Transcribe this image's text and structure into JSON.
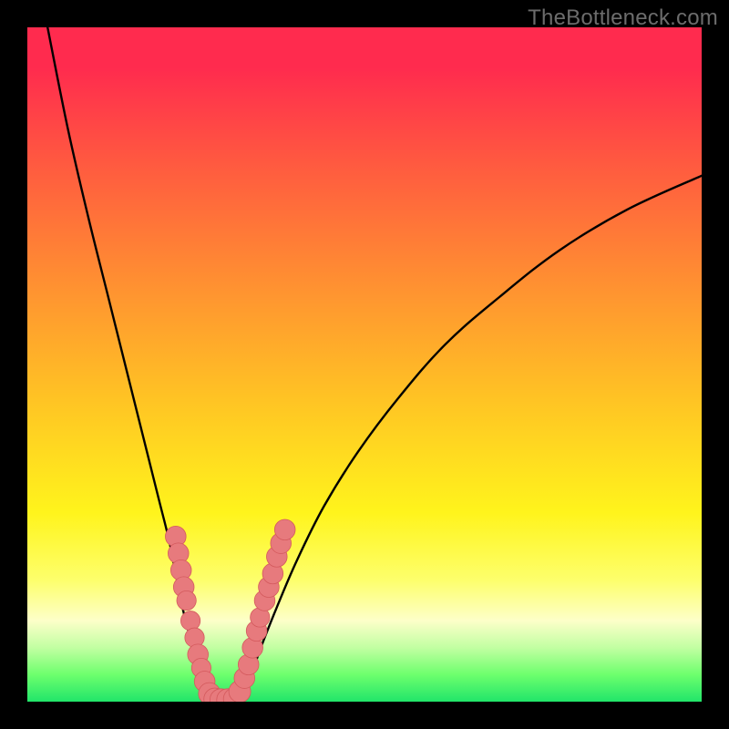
{
  "watermark": "TheBottleneck.com",
  "colors": {
    "frame": "#000000",
    "curve": "#000000",
    "marker_fill": "#e77a7d",
    "marker_stroke": "#d45a5d",
    "gradient_stops": [
      "#ff2b4e",
      "#ff5940",
      "#ff8a33",
      "#ffc324",
      "#fff41c",
      "#fdff6c",
      "#fdffc9",
      "#c2ffa2",
      "#6dff6d",
      "#21e56a"
    ]
  },
  "chart_data": {
    "type": "line",
    "title": "",
    "xlabel": "",
    "ylabel": "",
    "xlim": [
      0,
      100
    ],
    "ylim": [
      0,
      100
    ],
    "series": [
      {
        "name": "left-curve",
        "x": [
          3,
          6,
          9,
          12,
          14,
          16,
          18,
          19.5,
          21,
          22,
          23,
          24,
          25,
          25.8,
          26.5,
          27
        ],
        "y": [
          100,
          85,
          72,
          60,
          52,
          44,
          36,
          30,
          24,
          19,
          14,
          10,
          6,
          3.5,
          1.5,
          0.3
        ]
      },
      {
        "name": "right-curve",
        "x": [
          31,
          32,
          33.5,
          35,
          37,
          40,
          44,
          49,
          55,
          62,
          70,
          79,
          89,
          100
        ],
        "y": [
          0.3,
          2,
          5,
          9,
          14,
          21,
          29,
          37,
          45,
          53,
          60,
          67,
          73,
          78
        ]
      },
      {
        "name": "valley-floor",
        "x": [
          27,
          31
        ],
        "y": [
          0.3,
          0.3
        ]
      }
    ],
    "markers": {
      "name": "data-points",
      "points": [
        {
          "x": 22.0,
          "y": 24.5,
          "r": 1.1
        },
        {
          "x": 22.4,
          "y": 22.0,
          "r": 1.1
        },
        {
          "x": 22.8,
          "y": 19.5,
          "r": 1.1
        },
        {
          "x": 23.2,
          "y": 17.0,
          "r": 1.1
        },
        {
          "x": 23.6,
          "y": 15.0,
          "r": 1.0
        },
        {
          "x": 24.2,
          "y": 12.0,
          "r": 1.0
        },
        {
          "x": 24.8,
          "y": 9.5,
          "r": 1.0
        },
        {
          "x": 25.3,
          "y": 7.0,
          "r": 1.1
        },
        {
          "x": 25.8,
          "y": 5.0,
          "r": 1.0
        },
        {
          "x": 26.3,
          "y": 3.0,
          "r": 1.1
        },
        {
          "x": 27.0,
          "y": 1.2,
          "r": 1.2
        },
        {
          "x": 27.8,
          "y": 0.4,
          "r": 1.2
        },
        {
          "x": 28.7,
          "y": 0.3,
          "r": 1.2
        },
        {
          "x": 29.7,
          "y": 0.3,
          "r": 1.2
        },
        {
          "x": 30.7,
          "y": 0.4,
          "r": 1.2
        },
        {
          "x": 31.5,
          "y": 1.5,
          "r": 1.2
        },
        {
          "x": 32.2,
          "y": 3.5,
          "r": 1.1
        },
        {
          "x": 32.8,
          "y": 5.5,
          "r": 1.1
        },
        {
          "x": 33.4,
          "y": 8.0,
          "r": 1.1
        },
        {
          "x": 34.0,
          "y": 10.5,
          "r": 1.1
        },
        {
          "x": 34.5,
          "y": 12.5,
          "r": 1.0
        },
        {
          "x": 35.2,
          "y": 15.0,
          "r": 1.1
        },
        {
          "x": 35.8,
          "y": 17.0,
          "r": 1.1
        },
        {
          "x": 36.4,
          "y": 19.0,
          "r": 1.1
        },
        {
          "x": 37.0,
          "y": 21.5,
          "r": 1.1
        },
        {
          "x": 37.6,
          "y": 23.5,
          "r": 1.1
        },
        {
          "x": 38.2,
          "y": 25.5,
          "r": 1.1
        }
      ]
    }
  }
}
